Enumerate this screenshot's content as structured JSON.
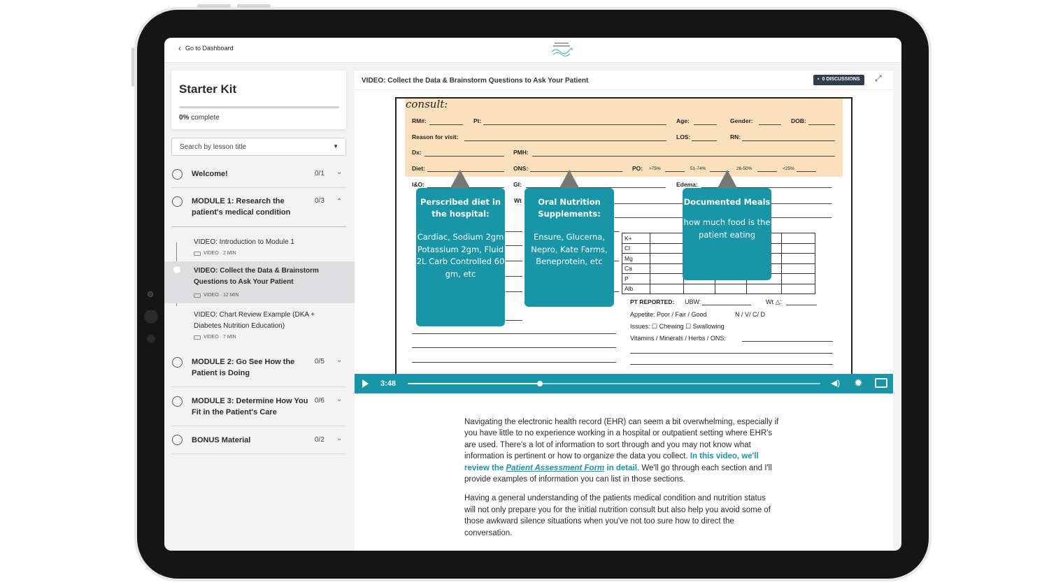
{
  "topbar": {
    "back_label": "Go to Dashboard",
    "logo_icon": "aspiring-logo-icon"
  },
  "sidebar": {
    "course_title": "Starter Kit",
    "progress_pct": "0%",
    "progress_suffix": " complete",
    "progress_value": 0,
    "search_placeholder": "Search by lesson title",
    "modules": [
      {
        "title": "Welcome!",
        "count": "0/1",
        "expanded": false
      },
      {
        "title": "MODULE 1: Research the patient's medical condition",
        "count": "0/3",
        "expanded": true,
        "lessons": [
          {
            "title": "VIDEO: Introduction to Module 1",
            "meta": "VIDEO · 2 MIN",
            "active": false
          },
          {
            "title": "VIDEO: Collect the Data & Brainstorm Questions to Ask Your Patient",
            "meta": "VIDEO · 12 MIN",
            "active": true
          },
          {
            "title": "VIDEO: Chart Review Example (DKA + Diabetes Nutrition Education)",
            "meta": "VIDEO · 7 MIN",
            "active": false
          }
        ]
      },
      {
        "title": "MODULE 2: Go See How the Patient is Doing",
        "count": "0/5",
        "expanded": false
      },
      {
        "title": "MODULE 3: Determine How You Fit in the Patient's Care",
        "count": "0/6",
        "expanded": false
      },
      {
        "title": "BONUS Material",
        "count": "0/2",
        "expanded": false
      }
    ]
  },
  "video": {
    "title": "VIDEO: Collect the Data & Brainstorm Questions to Ask Your Patient",
    "discussions_label": "0 DISCUSSIONS",
    "current_time": "3:48",
    "progress_fraction": 0.32,
    "form": {
      "heading": "consult:",
      "rm": "RM#:",
      "pt": "Pt:",
      "age": "Age:",
      "gender": "Gender:",
      "dob": "DOB:",
      "reason": "Reason for visit:",
      "los": "LOS:",
      "rn": "RN:",
      "dx": "Dx:",
      "pmh": "PMH:",
      "diet": "Diet:",
      "ons": "ONS:",
      "po": "PO:",
      "po_opts": [
        ">75%",
        "51-74%",
        "26-50%",
        "<25%"
      ],
      "io": "I&O:",
      "gi": "GI:",
      "edema": "Edema:",
      "wt": "Wt",
      "labs": [
        "K+",
        "Cl",
        "Mg",
        "Ca",
        "P",
        "Alb"
      ],
      "pt_reported": "PT REPORTED:",
      "ubw": "UBW:",
      "wt_delta": "Wt △:",
      "appetite": "Appetite: Poor / Fair / Good",
      "nvcd": "N / V/ C/ D",
      "issues": "Issues: ☐ Chewing ☐ Swallowing",
      "vitamins": "Vitamins / Minerals / Herbs / ONS:"
    },
    "callouts": [
      {
        "heading": "Perscribed diet in the hospital:",
        "body": "Cardiac, Sodium 2gm Potassium 2gm, Fluid 2L Carb Controlled 60 gm, etc"
      },
      {
        "heading": "Oral Nutrition Supplements:",
        "body": "Ensure, Glucerna, Nepro,  Kate Farms, Beneprotein, etc"
      },
      {
        "heading": "Documented Meals",
        "body": "how much food is the patient eating"
      }
    ]
  },
  "description": {
    "p1_a": "Navigating the electronic health record (EHR) can seem a bit overwhelming, especially if you have little to no experience working in a hospital or outpatient setting where EHR's are used. There's a lot of information to sort through and you may not know what information is pertinent or how to organize the data you collect. ",
    "p1_hl1": "In this video, we'll review the ",
    "p1_link": "Patient Assessment Form",
    "p1_hl2": " in detail",
    "p1_b": ". We'll go through each section and I'll provide examples of information you can list in those sections.",
    "p2": "Having a general understanding of the patients medical condition and nutrition status will not only prepare you for the initial nutrition consult but also help you avoid some of those awkward silence situations when you've not too sure how to direct the conversation."
  },
  "colors": {
    "accent": "#1896a8",
    "peach": "#fbe0bc",
    "badge": "#2f3d4e"
  }
}
